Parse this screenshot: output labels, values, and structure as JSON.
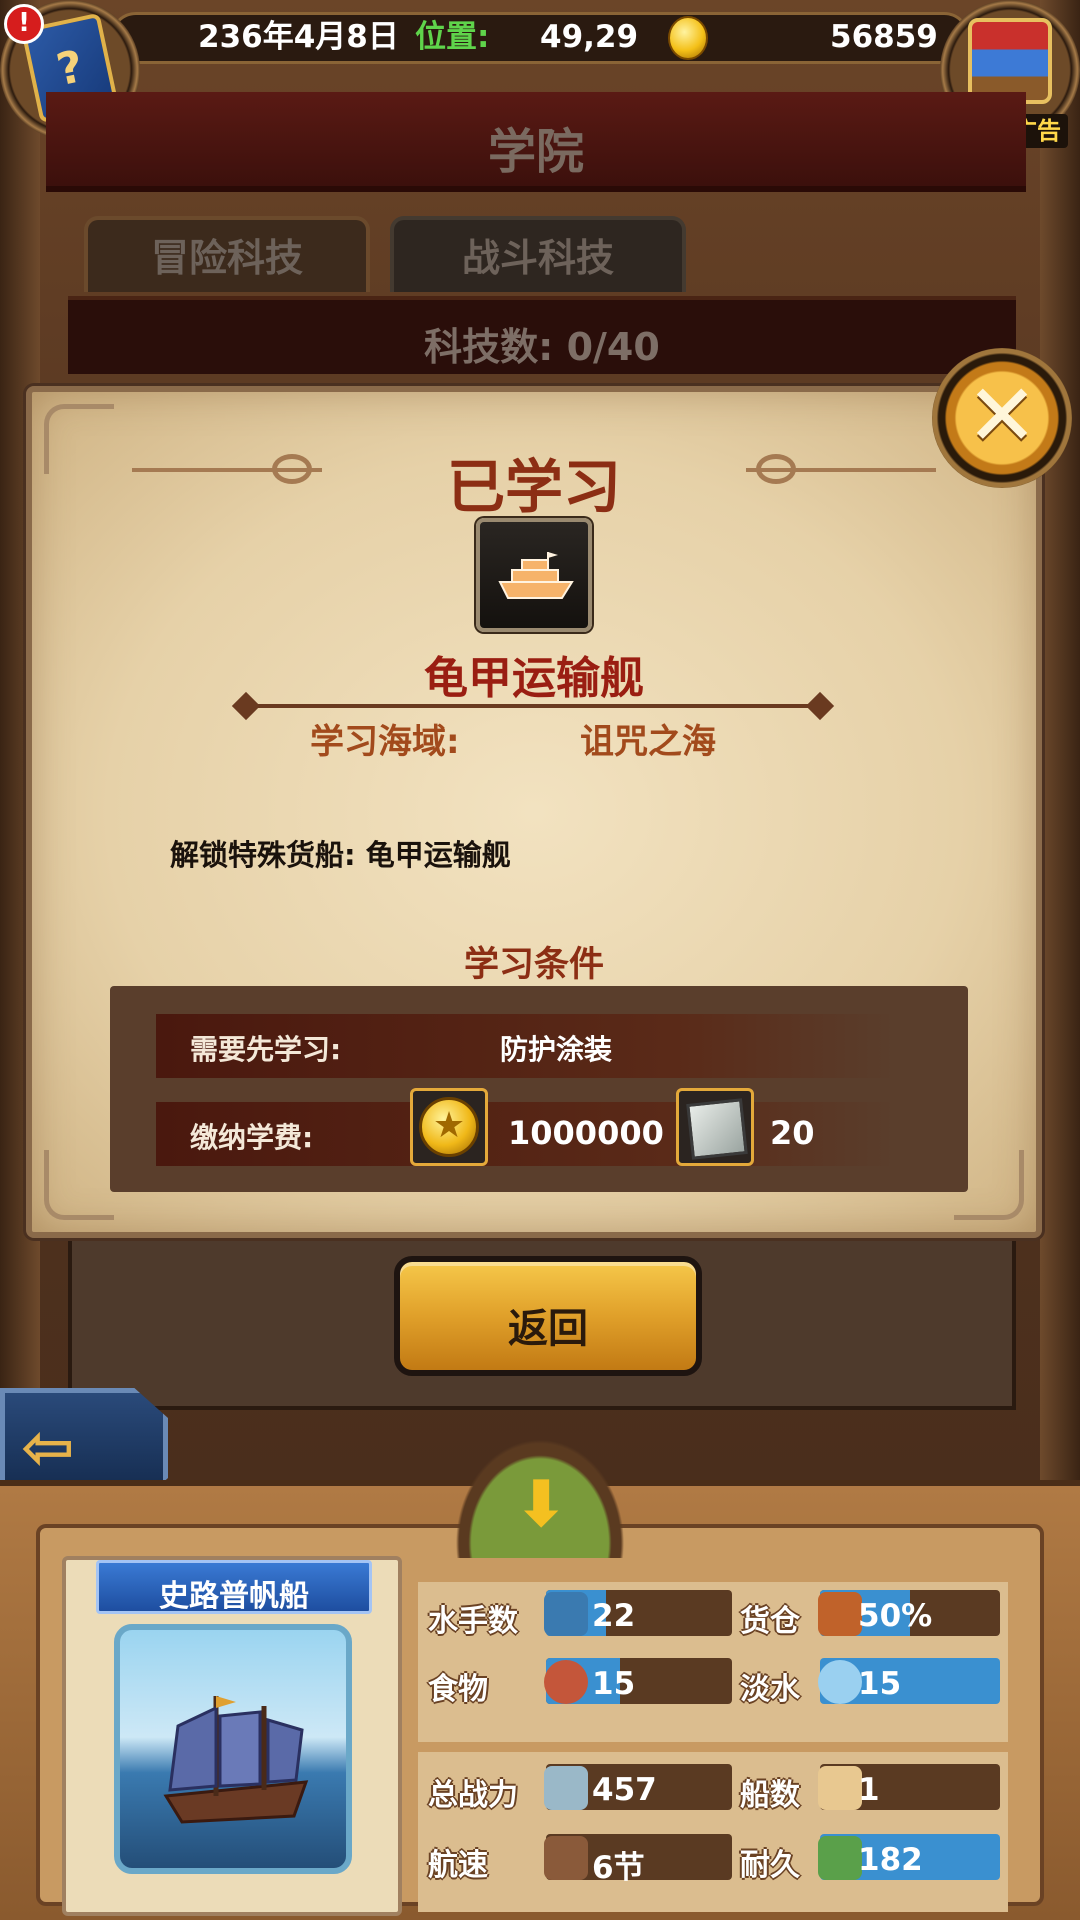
{
  "header": {
    "date": "236年4月8日",
    "position_label": "位置:",
    "position_value": "49,29",
    "gold": "56859",
    "no_ad_label": "暂无广告",
    "alert": "!"
  },
  "academy": {
    "title": "学院",
    "tabs": [
      {
        "label": "冒险科技"
      },
      {
        "label": "战斗科技"
      }
    ],
    "tech_count": "科技数: 0/40"
  },
  "modal": {
    "title": "已学习",
    "tech_name": "龟甲运输舰",
    "sea_label": "学习海域:",
    "sea_value": "诅咒之海",
    "unlock_text": "解锁特殊货船: 龟甲运输舰",
    "conditions_title": "学习条件",
    "prereq_label": "需要先学习:",
    "prereq_value": "防护涂装",
    "fee_label": "缴纳学费:",
    "fee_gold": "1000000",
    "fee_books": "20",
    "close_glyph": "✕"
  },
  "return_label": "返回",
  "left_arrow_glyph": "⇦",
  "collapse_glyph": "⬇",
  "ship": {
    "name": "史路普帆船",
    "stats": {
      "sailors": {
        "label": "水手数",
        "value": "22",
        "fill": 0.32
      },
      "cargo": {
        "label": "货仓",
        "value": "50%",
        "fill": 0.5
      },
      "food": {
        "label": "食物",
        "value": "15",
        "fill": 0.4
      },
      "water": {
        "label": "淡水",
        "value": "15",
        "fill": 1.0
      },
      "power": {
        "label": "总战力",
        "value": "457",
        "fill": 0.0
      },
      "ships": {
        "label": "船数",
        "value": "1",
        "fill": 0.0
      },
      "speed": {
        "label": "航速",
        "value": "6节",
        "fill": 0.0
      },
      "durability": {
        "label": "耐久",
        "value": "182",
        "fill": 1.0
      }
    }
  },
  "colors": {
    "accent_gold": "#f4c018",
    "title_red": "#8c2e14",
    "stat_fill_blue": "#3a90d0",
    "position_green": "#5fd44b"
  },
  "icons": {
    "book": "book-icon",
    "chest": "treasure-chest-icon",
    "coin": "gold-coin-icon",
    "tech": "ship-icon",
    "close": "close-icon",
    "back": "arrow-left-icon",
    "collapse": "chevron-down-icon"
  }
}
